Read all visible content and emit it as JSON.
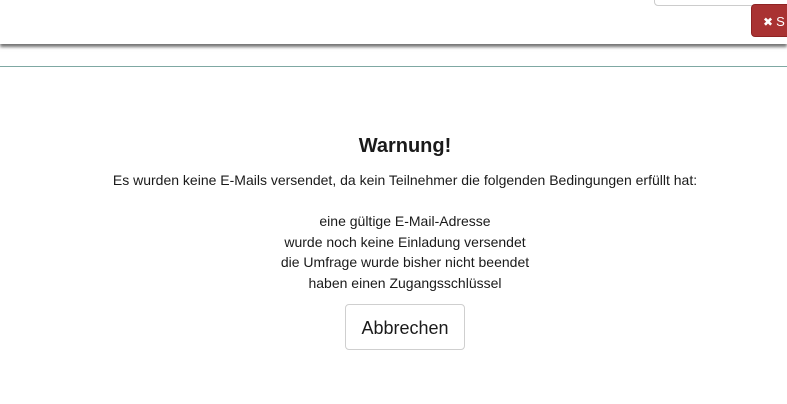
{
  "header": {
    "save_label": "S",
    "save_icon": "close-icon"
  },
  "dialog": {
    "title": "Warnung!",
    "intro": "Es wurden keine E-Mails versendet, da kein Teilnehmer die folgenden Bedingungen erfüllt hat:",
    "conditions": [
      "eine gültige E-Mail-Adresse",
      "wurde noch keine Einladung versendet",
      "die Umfrage wurde bisher nicht beendet",
      "haben einen Zugangsschlüssel"
    ],
    "cancel_label": "Abbrechen"
  },
  "colors": {
    "save_button": "#a93232",
    "divider": "#7fa8a3"
  }
}
